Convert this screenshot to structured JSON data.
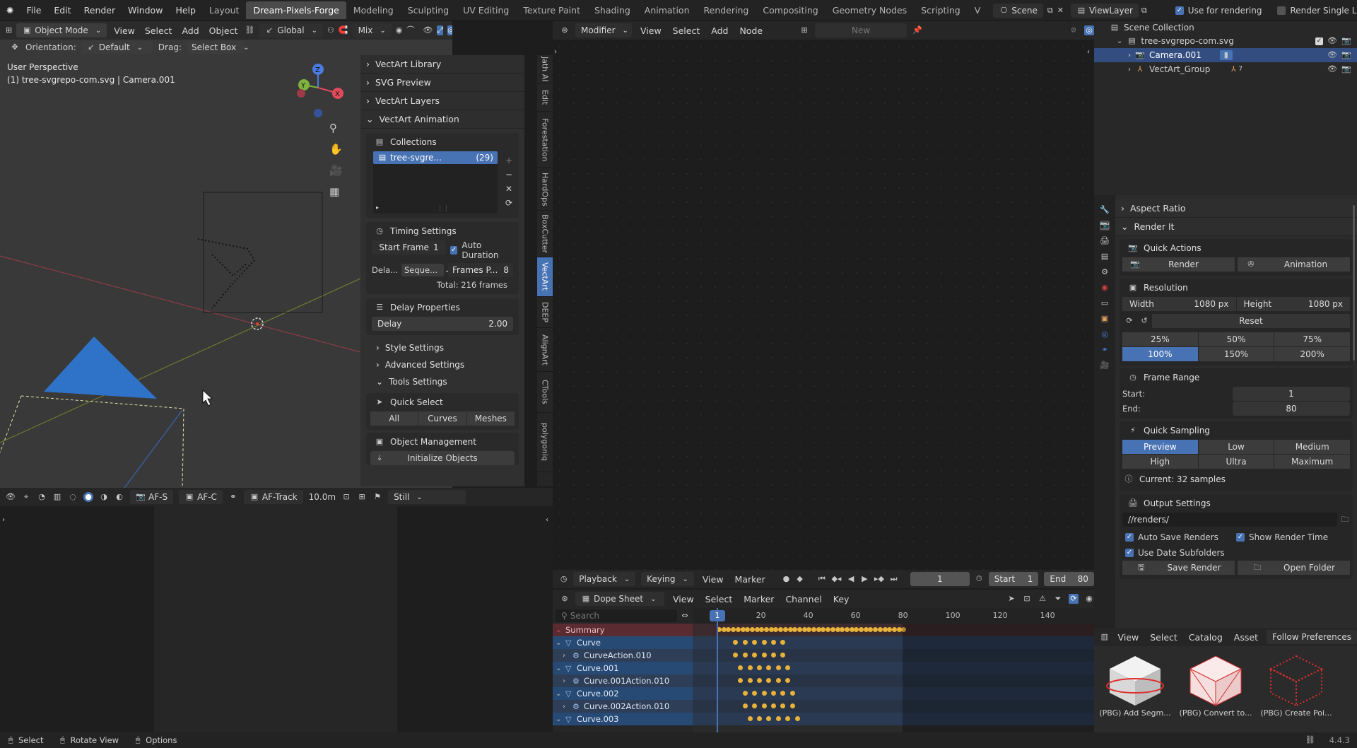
{
  "topbar": {
    "menus": [
      "File",
      "Edit",
      "Render",
      "Window",
      "Help"
    ],
    "workspaces": [
      "Layout",
      "Dream-Pixels-Forge",
      "Modeling",
      "Sculpting",
      "UV Editing",
      "Texture Paint",
      "Shading",
      "Animation",
      "Rendering",
      "Compositing",
      "Geometry Nodes",
      "Scripting",
      "V"
    ],
    "active_workspace": "Dream-Pixels-Forge",
    "scene": "Scene",
    "view_layer": "ViewLayer",
    "use_for_rendering": "Use for rendering",
    "render_single_layer": "Render Single Layer"
  },
  "viewport": {
    "mode": "Object Mode",
    "menus": [
      "View",
      "Select",
      "Add",
      "Object"
    ],
    "transform": "Global",
    "mix": "Mix",
    "orientation_label": "Orientation:",
    "orientation_value": "Default",
    "drag_label": "Drag:",
    "drag_value": "Select Box",
    "options": "Options",
    "perspective": "User Perspective",
    "object_info": "(1) tree-svgrepo-com.svg | Camera.001",
    "gizmo_x": "X",
    "gizmo_y": "Y",
    "gizmo_z": "Z"
  },
  "sidebar": {
    "vtabs": [
      "Jath AI",
      "Edit",
      "Forestation",
      "HardOps",
      "BoxCutter",
      "VectArt",
      "DEEP",
      "AlignArt",
      "CTools",
      "polygoniq"
    ],
    "active_vtab": "VectArt",
    "sections": {
      "library": "VectArt Library",
      "svg_preview": "SVG Preview",
      "layers": "VectArt Layers",
      "animation": "VectArt Animation"
    },
    "collections": {
      "title": "Collections",
      "item_name": "tree-svgre...",
      "item_count": "(29)"
    },
    "timing": {
      "title": "Timing Settings",
      "start_frame_label": "Start Frame",
      "start_frame_value": "1",
      "auto_duration": "Auto Duration",
      "delay_mode_label": "Dela...",
      "delay_mode_value": "Seque...",
      "frames_per_label": "Frames P...",
      "frames_per_value": "8",
      "total": "Total: 216 frames"
    },
    "delay": {
      "title": "Delay Properties",
      "label": "Delay",
      "value": "2.00"
    },
    "style": "Style Settings",
    "advanced": "Advanced Settings",
    "tools": "Tools Settings",
    "quick_select": {
      "title": "Quick Select",
      "all": "All",
      "curves": "Curves",
      "meshes": "Meshes"
    },
    "object_management": {
      "title": "Object Management",
      "initialize": "Initialize Objects"
    }
  },
  "viewport_footer": {
    "af_s": "AF-S",
    "af_c": "AF-C",
    "af_track": "AF-Track",
    "distance": "10.0m",
    "still": "Still"
  },
  "node_editor": {
    "menu_modifier": "Modifier",
    "menus": [
      "View",
      "Select",
      "Add",
      "Node"
    ],
    "new": "New"
  },
  "timeline": {
    "menus": [
      "Playback",
      "Keying",
      "View",
      "Marker"
    ],
    "current_frame": "1",
    "start_label": "Start",
    "start_value": "1",
    "end_label": "End",
    "end_value": "80"
  },
  "dopesheet": {
    "mode": "Dope Sheet",
    "menus": [
      "View",
      "Select",
      "Marker",
      "Channel",
      "Key"
    ],
    "search_placeholder": "Search",
    "frame_badge": "1",
    "ruler": [
      "20",
      "40",
      "60",
      "80",
      "100",
      "120",
      "140"
    ],
    "channels": [
      {
        "name": "Summary",
        "type": "summary"
      },
      {
        "name": "Curve",
        "type": "object"
      },
      {
        "name": "CurveAction.010",
        "type": "action"
      },
      {
        "name": "Curve.001",
        "type": "object"
      },
      {
        "name": "Curve.001Action.010",
        "type": "action"
      },
      {
        "name": "Curve.002",
        "type": "object"
      },
      {
        "name": "Curve.002Action.010",
        "type": "action"
      },
      {
        "name": "Curve.003",
        "type": "object"
      }
    ]
  },
  "outliner": {
    "root": "Scene Collection",
    "collection": "tree-svgrepo-com.svg",
    "camera": "Camera.001",
    "group": "VectArt_Group",
    "group_badge": "7"
  },
  "properties": {
    "aspect_ratio": "Aspect Ratio",
    "render_it": "Render It",
    "quick_actions": "Quick Actions",
    "render": "Render",
    "animation": "Animation",
    "resolution": "Resolution",
    "width_label": "Width",
    "width_value": "1080 px",
    "height_label": "Height",
    "height_value": "1080 px",
    "reset": "Reset",
    "scales_row1": [
      "25%",
      "50%",
      "75%"
    ],
    "scales_row2": [
      "100%",
      "150%",
      "200%"
    ],
    "frame_range": "Frame Range",
    "start_label": "Start:",
    "start_value": "1",
    "end_label": "End:",
    "end_value": "80",
    "quick_sampling": "Quick Sampling",
    "samples_row1": [
      "Preview",
      "Low",
      "Medium"
    ],
    "samples_row2": [
      "High",
      "Ultra",
      "Maximum"
    ],
    "current": "Current: 32 samples",
    "output_settings": "Output Settings",
    "output_path": "//renders/",
    "auto_save": "Auto Save Renders",
    "show_time": "Show Render Time",
    "date_subfolders": "Use Date Subfolders",
    "save_render": "Save Render",
    "open_folder": "Open Folder"
  },
  "asset_browser": {
    "menus": [
      "View",
      "Select",
      "Catalog",
      "Asset"
    ],
    "follow_prefs": "Follow Preferences",
    "assets": [
      "(PBG) Add Segm...",
      "(PBG) Convert to...",
      "(PBG) Create Poi..."
    ]
  },
  "statusbar": {
    "select": "Select",
    "rotate": "Rotate View",
    "options": "Options",
    "version": "4.4.3"
  },
  "colors": {
    "accent": "#4772b3",
    "key": "#e8b23a",
    "object_row": "#274a75"
  }
}
